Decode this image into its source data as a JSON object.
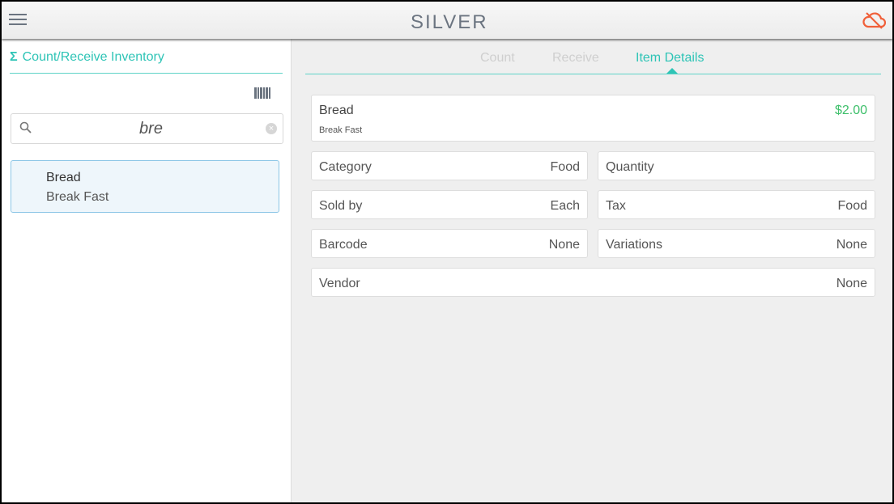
{
  "header": {
    "logo": "SILVER",
    "menu_icon": "hamburger-icon",
    "status_icon": "cloud-off-icon",
    "status_color": "#f0603a"
  },
  "left": {
    "title_icon": "Σ",
    "title": "Count/Receive Inventory",
    "search": {
      "value": "bre",
      "placeholder": ""
    },
    "results": [
      {
        "name": "Bread",
        "category": "Break Fast"
      }
    ]
  },
  "tabs": [
    {
      "label": "Count"
    },
    {
      "label": "Receive"
    },
    {
      "label": "Item Details",
      "active": true
    }
  ],
  "details": {
    "name": "Bread",
    "category_sub": "Break Fast",
    "price": "$2.00",
    "fields": {
      "category": {
        "label": "Category",
        "value": "Food"
      },
      "quantity": {
        "label": "Quantity",
        "value": ""
      },
      "sold_by": {
        "label": "Sold by",
        "value": "Each"
      },
      "tax": {
        "label": "Tax",
        "value": "Food"
      },
      "barcode": {
        "label": "Barcode",
        "value": "None"
      },
      "variations": {
        "label": "Variations",
        "value": "None"
      },
      "vendor": {
        "label": "Vendor",
        "value": "None"
      }
    }
  },
  "colors": {
    "accent": "#2ec4b6",
    "price": "#3dbf6a"
  }
}
